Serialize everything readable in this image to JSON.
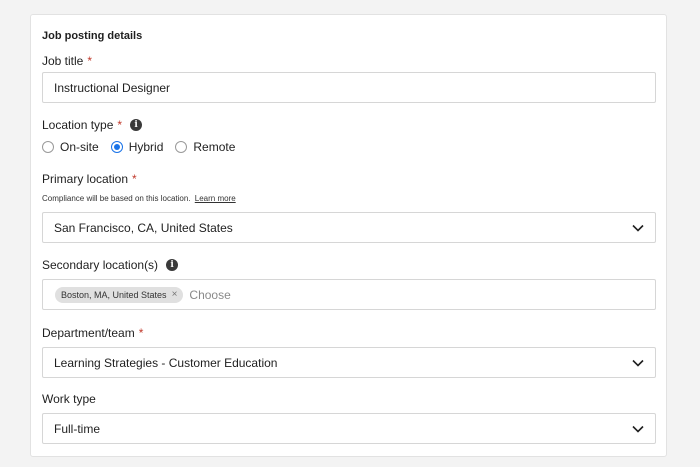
{
  "section": {
    "title": "Job posting details"
  },
  "job_title": {
    "label": "Job title",
    "required": "*",
    "value": "Instructional Designer"
  },
  "location_type": {
    "label": "Location type",
    "required": "*",
    "options": [
      {
        "label": "On-site",
        "selected": false
      },
      {
        "label": "Hybrid",
        "selected": true
      },
      {
        "label": "Remote",
        "selected": false
      }
    ]
  },
  "primary_location": {
    "label": "Primary location",
    "required": "*",
    "helper": "Compliance will be based on this location.",
    "helper_link": "Learn more",
    "value": "San Francisco, CA, United States"
  },
  "secondary_location": {
    "label": "Secondary location(s)",
    "chips": [
      {
        "label": "Boston, MA, United States"
      }
    ],
    "placeholder": "Choose"
  },
  "department": {
    "label": "Department/team",
    "required": "*",
    "value": "Learning Strategies - Customer Education"
  },
  "work_type": {
    "label": "Work type",
    "value": "Full-time"
  },
  "colors": {
    "accent": "#1a73e8",
    "required": "#c0392b"
  },
  "icons": {
    "info": "info-icon",
    "dropdown": "chevron-down-icon",
    "remove": "close-icon"
  }
}
